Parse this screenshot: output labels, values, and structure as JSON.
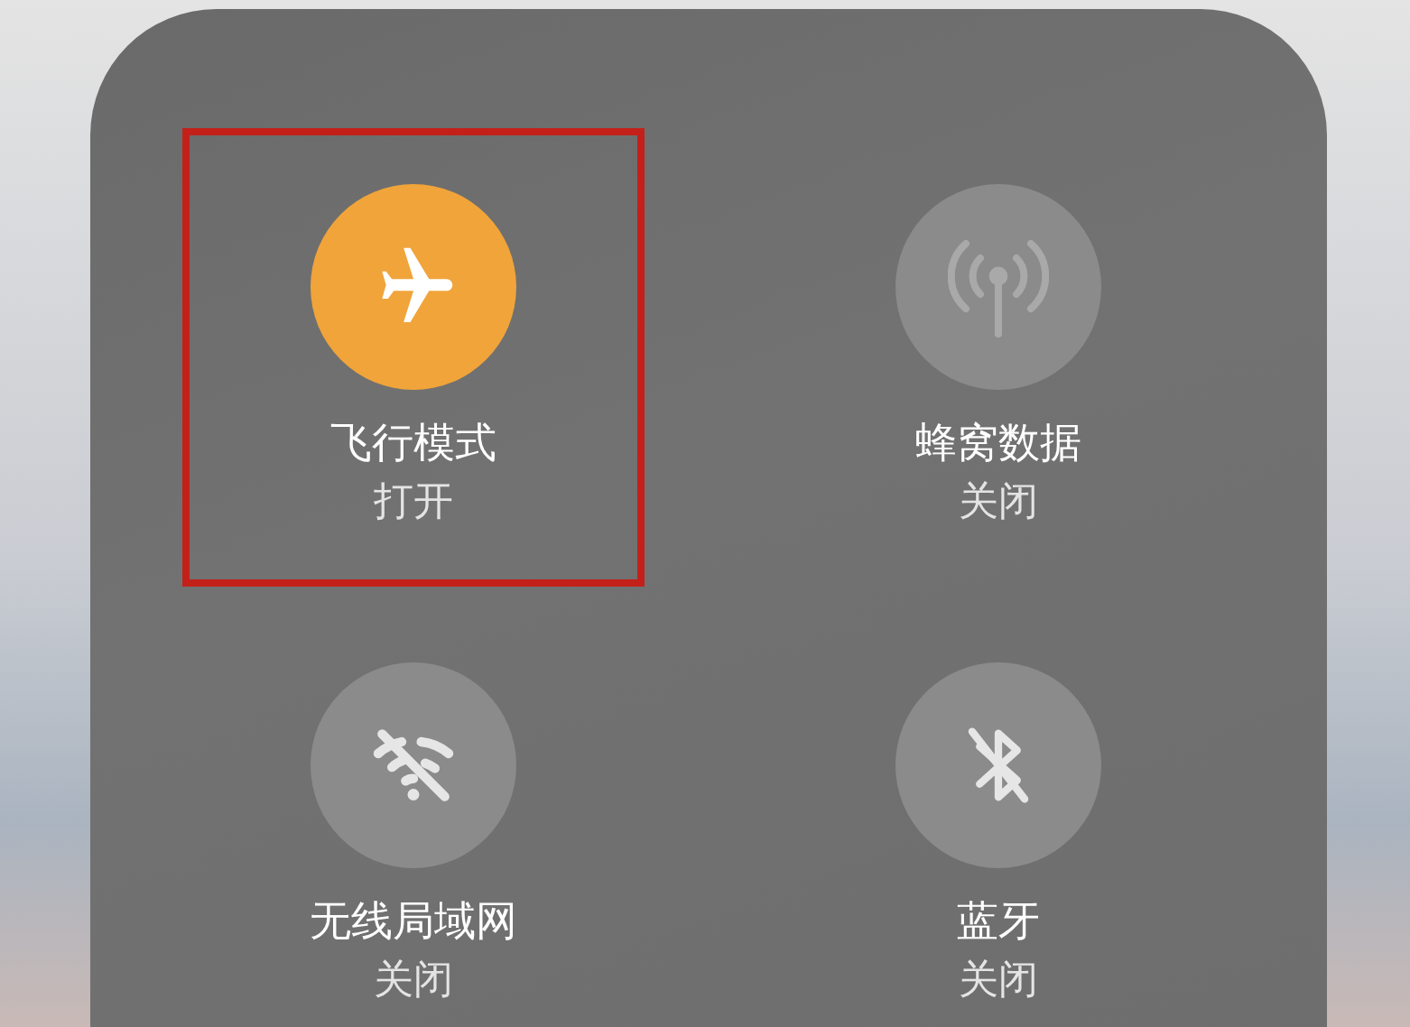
{
  "tiles": [
    {
      "kind": "airplane",
      "label": "飞行模式",
      "status": "打开",
      "on": true,
      "highlighted": true
    },
    {
      "kind": "cellular",
      "label": "蜂窝数据",
      "status": "关闭",
      "on": false,
      "highlighted": false
    },
    {
      "kind": "wifi",
      "label": "无线局域网",
      "status": "关闭",
      "on": false,
      "highlighted": false
    },
    {
      "kind": "bluetooth",
      "label": "蓝牙",
      "status": "关闭",
      "on": false,
      "highlighted": false
    }
  ]
}
